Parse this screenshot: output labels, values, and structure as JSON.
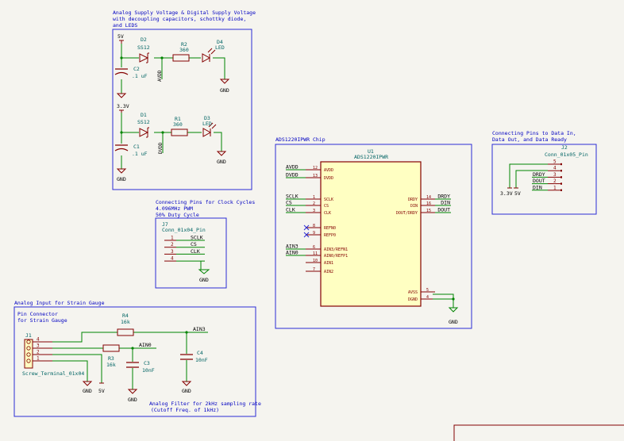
{
  "colors": {
    "wire": "#008400",
    "body": "#840000",
    "fill": "#ffffc2",
    "label": "#000000",
    "box": "#2b2bd6",
    "note": "#0000c2",
    "pin": "#840000",
    "ref": "#006464",
    "bg": "#f5f4ef"
  },
  "supply": {
    "title1": "Analog Supply Voltage & Digital Supply Voltage",
    "title2": "with decoupling capacitors, schottky diode,",
    "title3": "and LEDS",
    "v5": "5V",
    "v33": "3.3V",
    "d2": "D2",
    "d2v": "SS12",
    "r2": "R2",
    "r2v": "360",
    "d4": "D4",
    "d4v": "LED",
    "c2": "C2",
    "c2v": ".1 uF",
    "avdd": "AVDD",
    "d1": "D1",
    "d1v": "SS12",
    "r1": "R1",
    "r1v": "360",
    "d3": "D3",
    "d3v": "LED",
    "c1": "C1",
    "c1v": ".1 uF",
    "dvdd": "DVDD",
    "gnd": "GND"
  },
  "clock": {
    "title1": "Connecting Pins for Clock Cycles",
    "title2": "4.096MHz PWM",
    "title3": "50% Duty Cycle",
    "ref": "J7",
    "value": "Conn_01x04_Pin",
    "pins": [
      "1",
      "2",
      "3",
      "4"
    ],
    "nets": [
      "SCLK",
      "CS",
      "CLK"
    ],
    "gnd": "GND"
  },
  "adc": {
    "title": "ADS1220IPWR Chip",
    "ref": "U1",
    "value": "ADS1220IPWR",
    "left_pins": [
      {
        "net": "AVDD",
        "num": "12",
        "name": "AVDD"
      },
      {
        "net": "DVDD",
        "num": "13",
        "name": "DVDD"
      },
      {
        "net": "SCLK",
        "num": "1",
        "name": "SCLK"
      },
      {
        "net": "CS",
        "num": "2",
        "name": "CS"
      },
      {
        "net": "CLK",
        "num": "3",
        "name": "CLK"
      },
      {
        "net": "",
        "num": "8",
        "name": "REFN0"
      },
      {
        "net": "",
        "num": "9",
        "name": "REFP0"
      },
      {
        "net": "AIN3",
        "num": "6",
        "name": "AIN3/REFN1"
      },
      {
        "net": "AIN0",
        "num": "11",
        "name": "AIN0/REFP1"
      },
      {
        "net": "",
        "num": "10",
        "name": "AIN1"
      },
      {
        "net": "",
        "num": "7",
        "name": "AIN2"
      }
    ],
    "right_pins": [
      {
        "net": "DRDY",
        "num": "14",
        "name": "DRDY"
      },
      {
        "net": "DIN",
        "num": "16",
        "name": "DIN"
      },
      {
        "net": "DOUT",
        "num": "15",
        "name": "DOUT/DRDY"
      },
      {
        "net": "",
        "num": "5",
        "name": "AVSS"
      },
      {
        "net": "",
        "num": "4",
        "name": "DGND"
      }
    ],
    "gnd": "GND"
  },
  "data_conn": {
    "title1": "Connecting Pins to Data In,",
    "title2": "Data Out, and Data Ready",
    "ref": "J2",
    "value": "Conn_01x05_Pin",
    "pins": [
      "5",
      "4",
      "3",
      "2",
      "1"
    ],
    "nets": [
      "DRDY",
      "DOUT",
      "DIN"
    ],
    "v33": "3.3V",
    "v5": "5V"
  },
  "analog": {
    "title": "Analog Input for Strain Gauge",
    "sub1": "Pin Connector",
    "sub2": "for Strain Gauge",
    "ref": "J1",
    "value": "Screw_Terminal_01x04",
    "pins": [
      "4",
      "3",
      "2",
      "1"
    ],
    "r4": "R4",
    "r4v": "16k",
    "r3": "R3",
    "r3v": "16k",
    "c3": "C3",
    "c3v": "10nF",
    "c4": "C4",
    "c4v": "10nF",
    "ain3": "AIN3",
    "ain0": "AIN0",
    "gnd": "GND",
    "v5": "5V",
    "filter1": "Analog Filter for 2kHz sampling rate",
    "filter2": "(Cutoff Freq. of 1kHz)"
  }
}
